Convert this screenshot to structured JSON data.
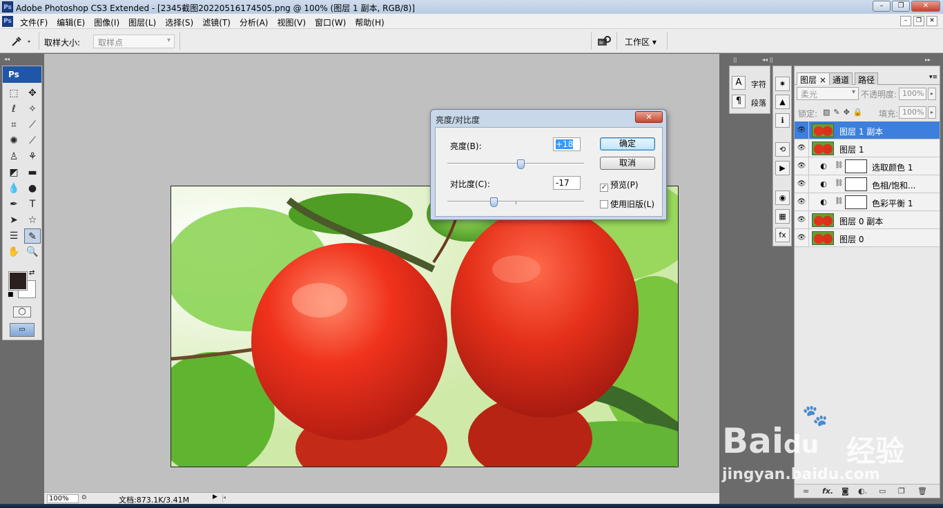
{
  "app": {
    "logo_text": "Ps",
    "title": "Adobe Photoshop CS3 Extended - [2345截图20220516174505.png @ 100% (图层 1 副本, RGB/8)]",
    "window_controls": [
      "–",
      "❐",
      "✕"
    ]
  },
  "menu": {
    "items": [
      "文件(F)",
      "编辑(E)",
      "图像(I)",
      "图层(L)",
      "选择(S)",
      "滤镜(T)",
      "分析(A)",
      "视图(V)",
      "窗口(W)",
      "帮助(H)"
    ],
    "doc_controls": [
      "–",
      "❐",
      "✕"
    ]
  },
  "options": {
    "sample_label": "取样大小:",
    "sample_value": "取样点",
    "workspace_label": "工作区 ▾",
    "bridge_icon": "bridge-icon"
  },
  "toolbox": {
    "header": "Ps",
    "tools": [
      "marquee-icon",
      "move-icon",
      "lasso-icon",
      "magic-wand-icon",
      "crop-icon",
      "slice-icon",
      "healing-icon",
      "brush-icon",
      "stamp-icon",
      "history-brush-icon",
      "eraser-icon",
      "gradient-icon",
      "blur-icon",
      "dodge-icon",
      "pen-icon",
      "type-icon",
      "path-select-icon",
      "shape-icon",
      "notes-icon",
      "eyedropper-icon",
      "hand-icon",
      "zoom-icon"
    ],
    "active_tool": "eyedropper-icon",
    "foreground_color": "#2b2020",
    "background_color": "#ffffff"
  },
  "status": {
    "zoom": "100%",
    "doc_info": "文档:873.1K/3.41M"
  },
  "dialog": {
    "title": "亮度/对比度",
    "close": "✕",
    "brightness_label": "亮度(B):",
    "brightness_value": "+18",
    "brightness_fraction": 0.54,
    "contrast_label": "对比度(C):",
    "contrast_value": "-17",
    "contrast_fraction": 0.33,
    "ok_label": "确定",
    "cancel_label": "取消",
    "preview_label": "预览(P)",
    "preview_checked": true,
    "legacy_label": "使用旧版(L)",
    "legacy_checked": false
  },
  "char_panel": {
    "character": "字符",
    "paragraph": "段落"
  },
  "layers_panel": {
    "tabs": [
      "图层 ×",
      "通道",
      "路径"
    ],
    "blend_mode": "柔光",
    "opacity_label": "不透明度:",
    "opacity_value": "100%",
    "lock_label": "锁定:",
    "fill_label": "填充:",
    "fill_value": "100%",
    "layers": [
      {
        "name": "图层 1 副本",
        "type": "pixel",
        "selected": true
      },
      {
        "name": "图层 1",
        "type": "pixel",
        "selected": false
      },
      {
        "name": "选取颜色 1",
        "type": "adjustment",
        "selected": false
      },
      {
        "name": "色相/饱和...",
        "type": "adjustment",
        "selected": false
      },
      {
        "name": "色彩平衡 1",
        "type": "adjustment",
        "selected": false
      },
      {
        "name": "图层 0 副本",
        "type": "pixel",
        "selected": false
      },
      {
        "name": "图层 0",
        "type": "pixel",
        "selected": false
      }
    ],
    "footer_icons": [
      "link-icon",
      "fx-icon",
      "mask-icon",
      "adjustment-icon",
      "group-icon",
      "new-layer-icon",
      "trash-icon"
    ]
  },
  "watermark": {
    "brand": "Bai",
    "brand2": "du",
    "cn": "经验",
    "url": "jingyan.baidu.com"
  }
}
